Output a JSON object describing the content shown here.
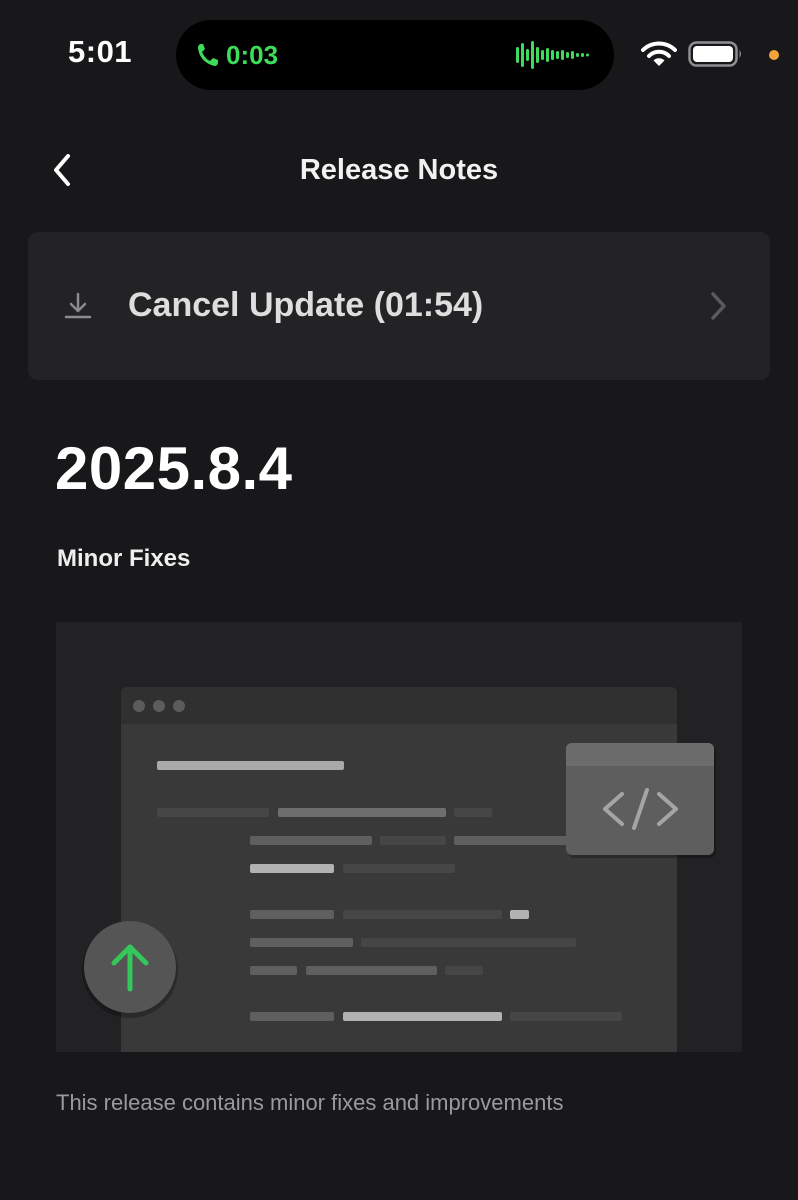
{
  "status_bar": {
    "time": "5:01",
    "call_timer": "0:03",
    "icons": [
      "phone-icon",
      "waveform-icon",
      "wifi-icon",
      "battery-icon"
    ],
    "call_color": "#3ddc5a",
    "privacy_dot_color": "#f2a33a"
  },
  "header": {
    "title": "Release Notes",
    "back_icon": "chevron-left-icon"
  },
  "update_card": {
    "label": "Cancel Update (01:54)",
    "icon": "download-icon",
    "trailing_icon": "chevron-right-icon"
  },
  "release": {
    "version": "2025.8.4",
    "subtitle": "Minor Fixes",
    "illustration_icons": [
      "code-icon",
      "arrow-up-icon"
    ],
    "description": "This release contains minor fixes and improvements",
    "accent_color": "#34c759"
  }
}
